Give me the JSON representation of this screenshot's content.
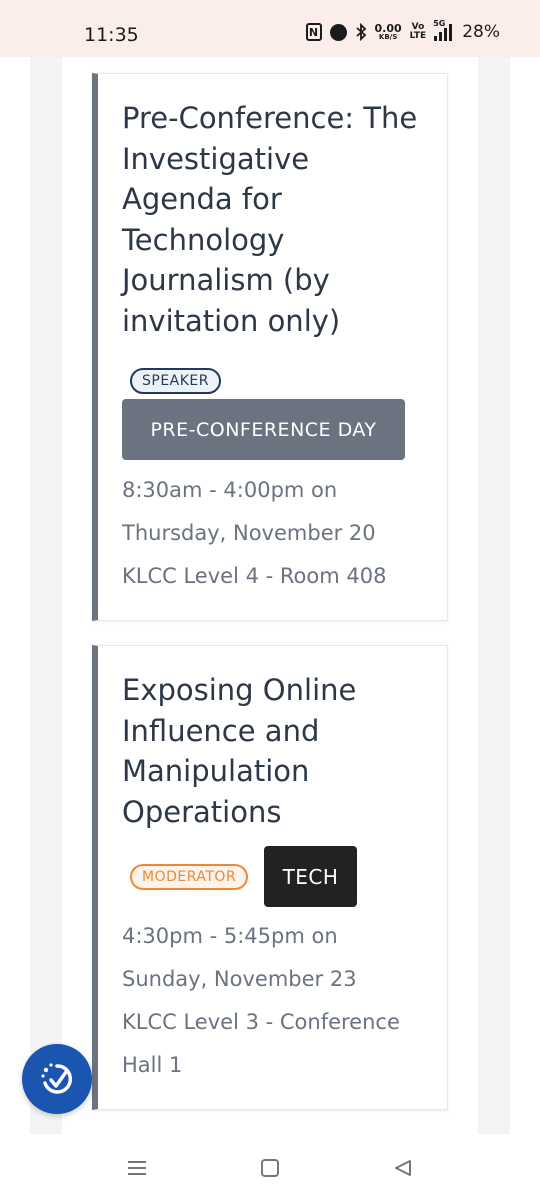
{
  "status_bar": {
    "time": "11:35",
    "nfc_label": "N",
    "speed_value": "0.00",
    "speed_unit": "KB/S",
    "volte_top": "Vo",
    "volte_bottom": "LTE",
    "network": "5G",
    "battery": "28%"
  },
  "sessions": [
    {
      "title": "Pre-Conference: The Investigative Agenda for Technology Journalism (by invitation only)",
      "role": "SPEAKER",
      "track": "PRE-CONFERENCE DAY",
      "time_line": "8:30am - 4:00pm on",
      "date_line": "Thursday, November 20",
      "location": "KLCC Level 4 - Room 408"
    },
    {
      "title": "Exposing Online Influence and Manipulation Operations",
      "role": "MODERATOR",
      "track": "TECH",
      "time_line": "4:30pm - 5:45pm on",
      "date_line": "Sunday, November 23",
      "location": "KLCC Level 3 - Conference Hall 1"
    }
  ],
  "colors": {
    "status_bar_bg": "#fbeeea",
    "card_accent": "#6b7280",
    "title_text": "#2d3748",
    "speaker_badge": "#1e3a5f",
    "moderator_badge": "#ed8936",
    "pre_conference_track": "#6b7280",
    "tech_track": "#222222",
    "accessibility_button": "#1a56b0"
  },
  "icons": {
    "accessibility": "accessibility-icon",
    "nav_menu": "recent-apps-icon",
    "nav_home": "home-icon",
    "nav_back": "back-icon"
  }
}
